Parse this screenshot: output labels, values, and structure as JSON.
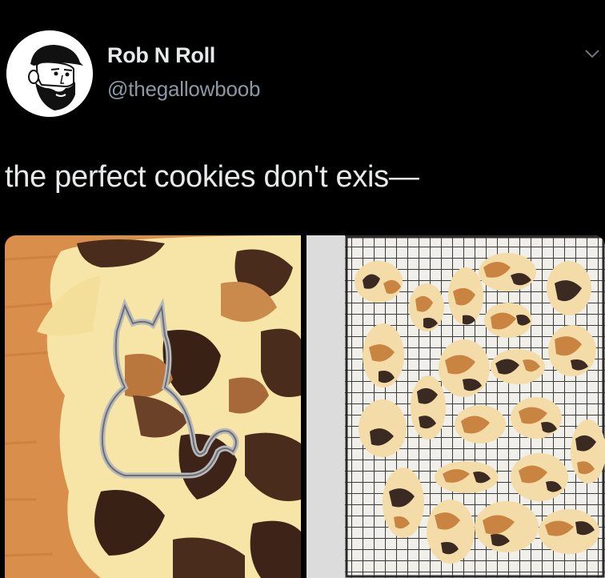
{
  "tweet": {
    "display_name": "Rob N Roll",
    "handle": "@thegallowboob",
    "text": "the perfect cookies don't exis—",
    "avatar_icon": "bearded-man-cartoon-avatar",
    "menu_icon": "chevron-down-icon"
  },
  "media": {
    "left_image": "cat-cookie-cutter-on-calico-dough",
    "right_image": "calico-cat-cookies-on-cooling-rack"
  },
  "colors": {
    "background": "#000000",
    "name": "#e7e9ea",
    "handle": "#8b98a5",
    "dough_light": "#f6e5a6",
    "dough_dark": "#4a2c1c",
    "dough_orange": "#c98a4c"
  }
}
